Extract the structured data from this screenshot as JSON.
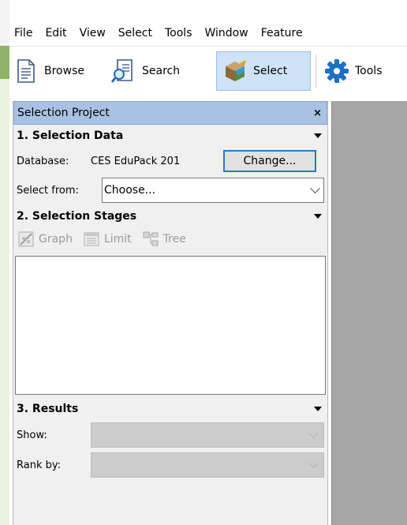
{
  "menu": {
    "items": [
      "File",
      "Edit",
      "View",
      "Select",
      "Tools",
      "Window",
      "Feature"
    ]
  },
  "toolbar": {
    "browse_label": "Browse",
    "search_label": "Search",
    "select_label": "Select",
    "tools_label": "Tools",
    "browse_icon": "document-icon",
    "search_icon": "search-document-icon",
    "select_icon": "cube-select-icon",
    "tools_icon": "gear-icon",
    "active_color": "#cfe3f7"
  },
  "panel": {
    "title": "Selection Project",
    "close_symbol": "×",
    "section1": {
      "title": "1. Selection Data",
      "database_label": "Database:",
      "database_value": "CES EduPack 201",
      "change_button": "Change...",
      "select_from_label": "Select from:",
      "select_from_value": "Choose..."
    },
    "section2": {
      "title": "2. Selection Stages",
      "graph_label": "Graph",
      "limit_label": "Limit",
      "tree_label": "Tree"
    },
    "section3": {
      "title": "3. Results",
      "show_label": "Show:",
      "rank_label": "Rank by:"
    }
  }
}
